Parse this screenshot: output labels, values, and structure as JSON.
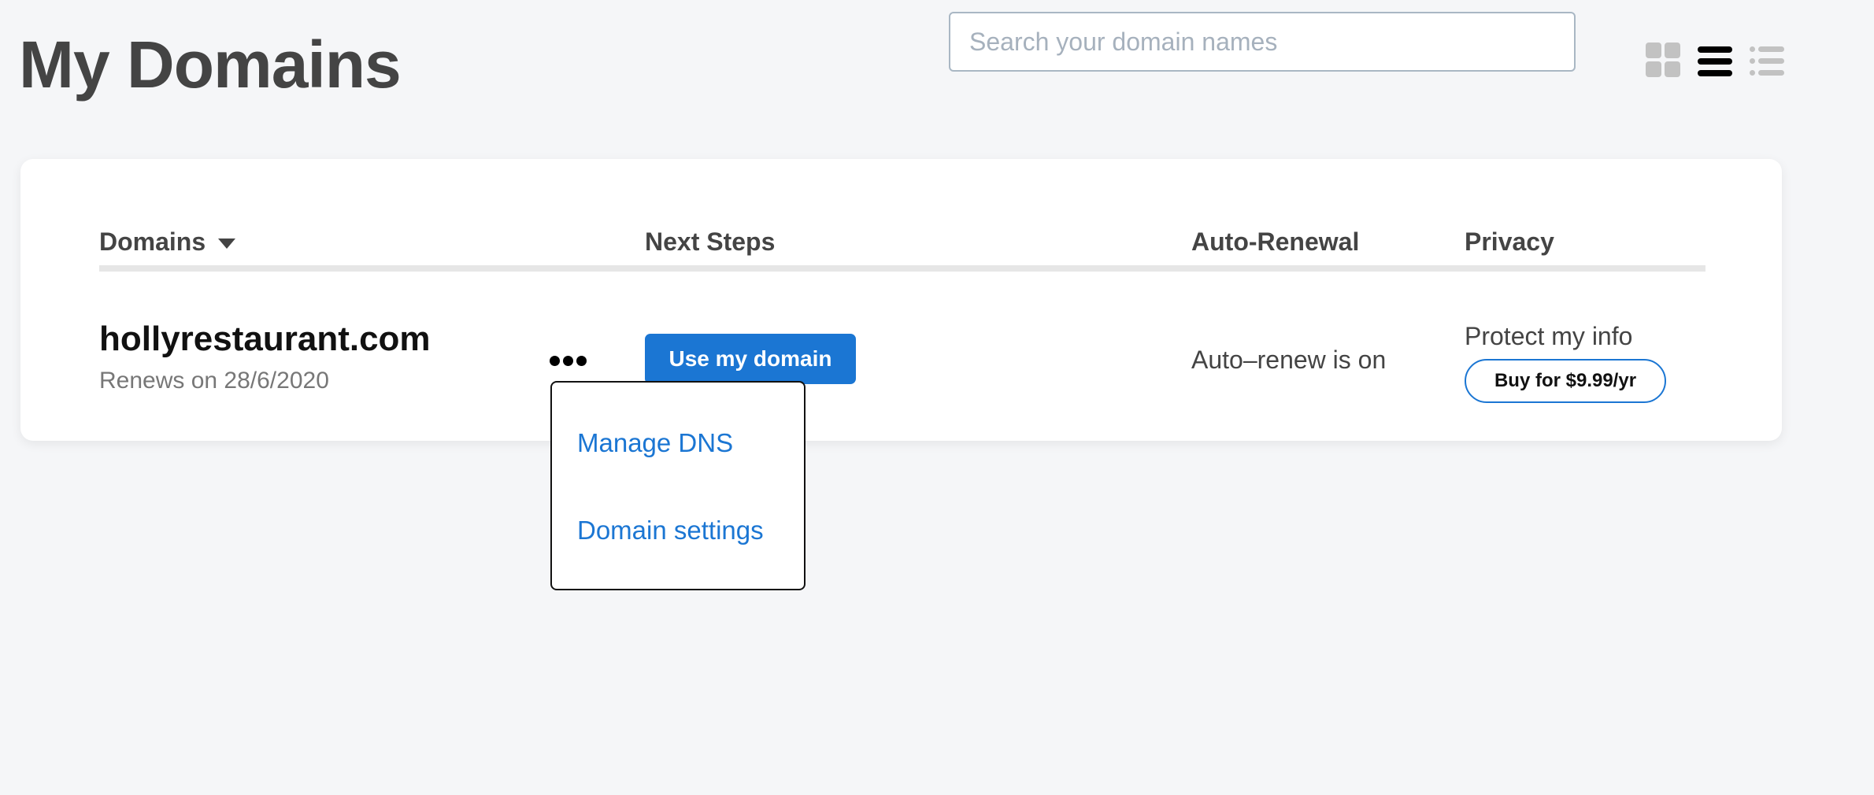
{
  "header": {
    "title": "My Domains",
    "search_placeholder": "Search your domain names",
    "search_value": ""
  },
  "view_toggle": [
    {
      "icon": "grid-icon",
      "label": "Grid view",
      "active": false
    },
    {
      "icon": "list-icon",
      "label": "List view",
      "active": true
    },
    {
      "icon": "compact-list-icon",
      "label": "Compact list view",
      "active": false
    }
  ],
  "table": {
    "columns": [
      "Domains",
      "Next Steps",
      "Auto-Renewal",
      "Privacy"
    ],
    "sort_column": "Domains",
    "rows": [
      {
        "domain": "hollyrestaurant.com",
        "renews": "Renews on 28/6/2020",
        "next_step_label": "Use my domain",
        "auto_renewal": "Auto–renew is on",
        "privacy_label": "Protect my info",
        "privacy_button": "Buy for $9.99/yr"
      }
    ]
  },
  "more_menu": {
    "open": true,
    "items": [
      "Manage DNS",
      "Domain settings"
    ]
  },
  "colors": {
    "accent": "#1b76d3",
    "background": "#f5f6f8",
    "text": "#444444"
  }
}
